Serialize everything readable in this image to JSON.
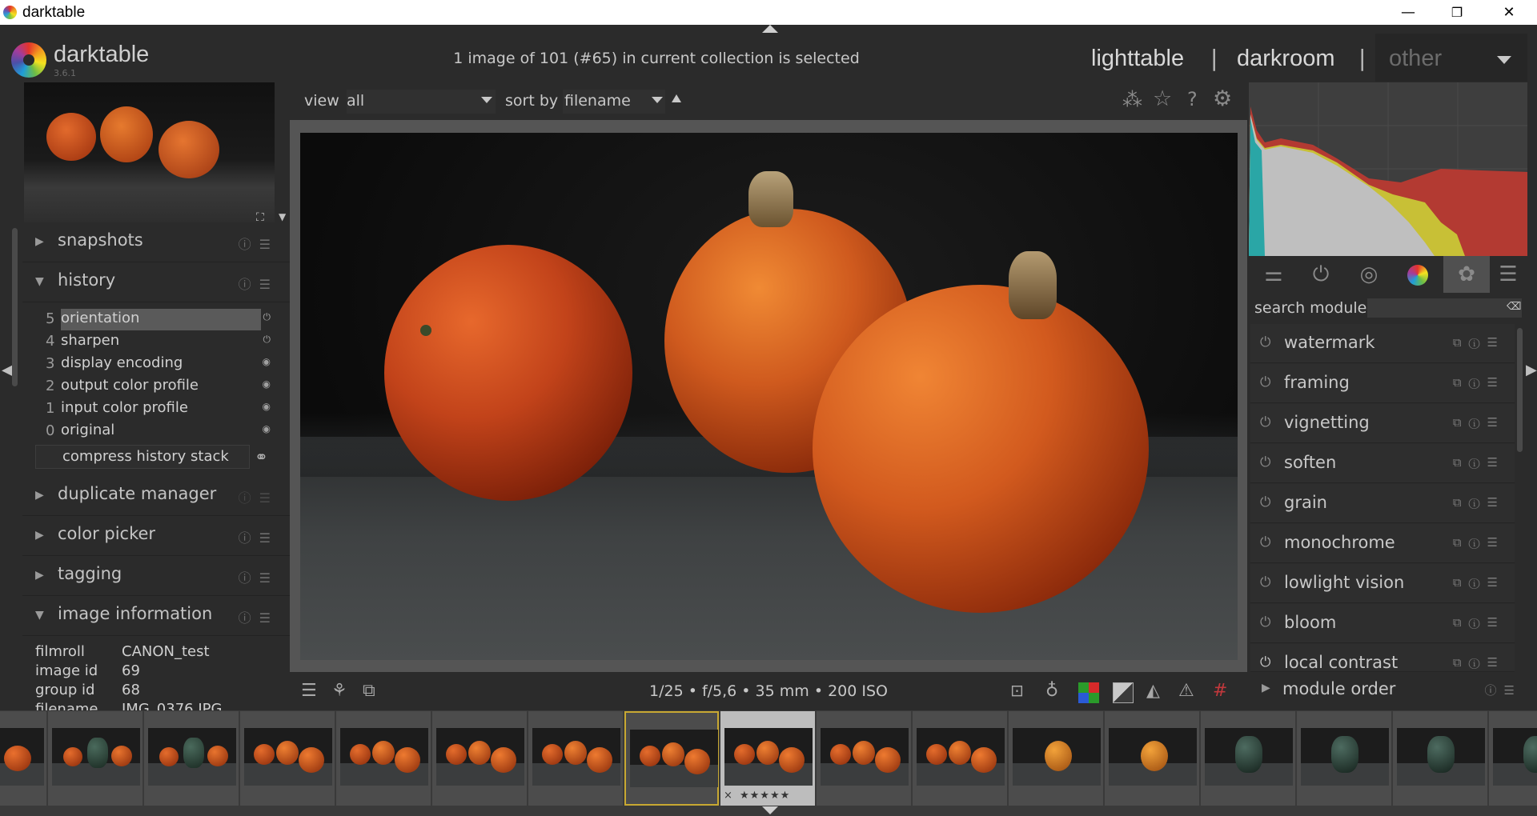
{
  "window": {
    "title": "darktable",
    "minimize": "—",
    "maximize": "❐",
    "close": "✕"
  },
  "header": {
    "app_name": "darktable",
    "version": "3.6.1",
    "status": "1 image of 101 (#65) in current collection is selected",
    "views": [
      "lighttable",
      "darkroom",
      "other"
    ],
    "separator": "|"
  },
  "left": {
    "sections": {
      "snapshots": "snapshots",
      "history": "history",
      "duplicate_manager": "duplicate manager",
      "color_picker": "color picker",
      "tagging": "tagging",
      "image_information": "image information"
    },
    "history_items": [
      {
        "num": "5",
        "name": "orientation"
      },
      {
        "num": "4",
        "name": "sharpen"
      },
      {
        "num": "3",
        "name": "display encoding"
      },
      {
        "num": "2",
        "name": "output color profile"
      },
      {
        "num": "1",
        "name": "input color profile"
      },
      {
        "num": "0",
        "name": "original"
      }
    ],
    "compress_label": "compress history stack",
    "image_info": [
      {
        "key": "filmroll",
        "value": "CANON_test"
      },
      {
        "key": "image id",
        "value": "69"
      },
      {
        "key": "group id",
        "value": "68"
      },
      {
        "key": "filename",
        "value": "IMG_0376.JPG"
      }
    ]
  },
  "center": {
    "view_label": "view",
    "view_value": "all",
    "sort_label": "sort by",
    "sort_value": "filename",
    "exif": "1/25 • f/5,6 • 35 mm • 200 ISO"
  },
  "right": {
    "search_label": "search module",
    "modules": [
      "watermark",
      "framing",
      "vignetting",
      "soften",
      "grain",
      "monochrome",
      "lowlight vision",
      "bloom",
      "local contrast"
    ],
    "module_order": "module order"
  },
  "filmstrip": {
    "rating": "★★★★★",
    "reject": "×"
  },
  "colors": {
    "selected_border": "#c8a832",
    "accent_orange": "#d4521a",
    "panel_bg": "#2b2b2b"
  }
}
